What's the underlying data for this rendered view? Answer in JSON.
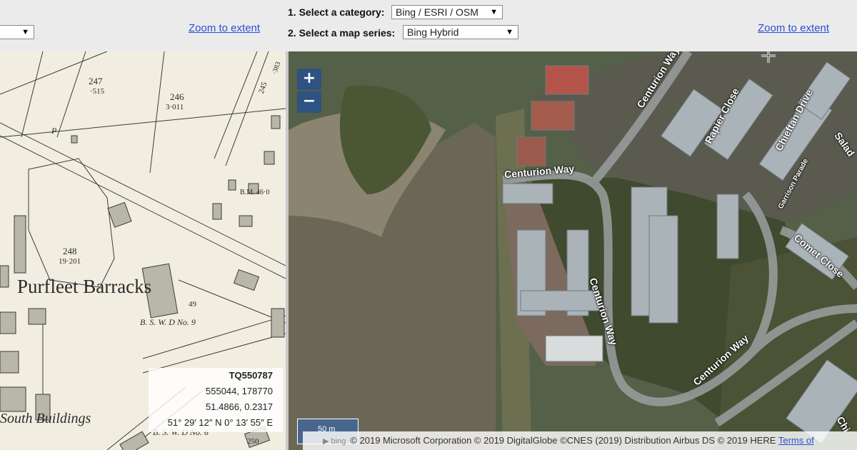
{
  "toolbar": {
    "left_select_value": "",
    "left_zoom_link": "Zoom to extent",
    "step1_label": "1. Select a category:",
    "category_value": "Bing / ESRI / OSM",
    "step2_label": "2. Select a map series:",
    "series_value": "Bing Hybrid",
    "right_zoom_link": "Zoom to extent",
    "dropdown_arrow": "▼"
  },
  "left_map": {
    "labels": {
      "barracks": "Purfleet Barracks",
      "south_buildings": "South Buildings",
      "parcel_247": "247",
      "parcel_247_area": "·515",
      "parcel_246": "246",
      "parcel_246_area": "3·011",
      "parcel_248": "248",
      "parcel_248_area": "19·201",
      "bsw_d9": "B. S. W. D No. 9",
      "bsw_d6": "B. S. W. D No. 6",
      "bm": "B.M. 46·0",
      "p_mark": "P",
      "n49": "49",
      "n245": "245",
      "n383": "·383",
      "n250": "250"
    }
  },
  "coords": {
    "grid_ref": "TQ550787",
    "easting_northing": "555044, 178770",
    "decimal": "51.4866, 0.2317",
    "dms": "51° 29′ 12″ N 0° 13′ 55″ E"
  },
  "right_map": {
    "zoom_in": "+",
    "zoom_out": "−",
    "scale_label": "50 m",
    "streets": {
      "centurion_way_1": "Centurion Way",
      "centurion_way_2": "Centurion Way",
      "centurion_way_3": "Centurion Way",
      "centurion_way_top": "Centurion Way",
      "rapier_close": "Rapier Close",
      "chieftan_drive": "Chieftan Drive",
      "garrison_parade": "Garrison Parade",
      "comet_close": "Comet Close",
      "salad": "Salad",
      "chi": "Chi"
    },
    "attribution": "© 2019 Microsoft Corporation © 2019 DigitalGlobe ©CNES (2019) Distribution Airbus DS © 2019 HERE",
    "terms_link": "Terms of",
    "bing_mark": "bing"
  },
  "colors": {
    "link": "#2a4fd6",
    "paper": "#f1eee1",
    "water": "#6b6756",
    "ctrl": "#28508c"
  }
}
